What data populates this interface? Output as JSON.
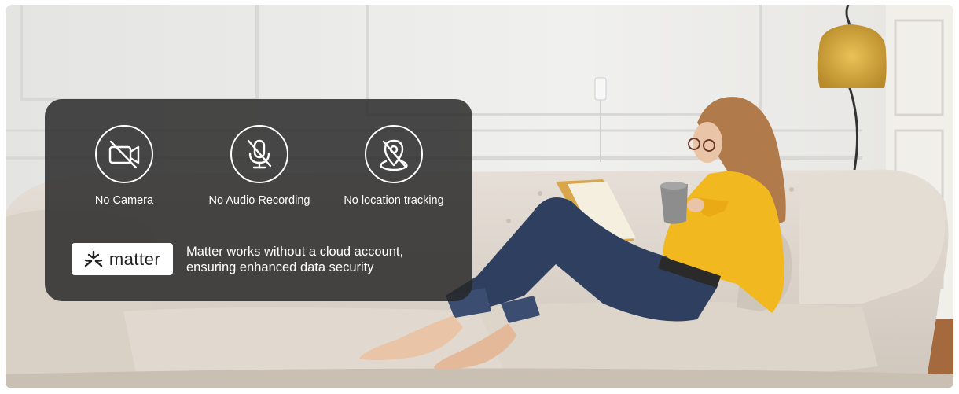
{
  "features": [
    {
      "label": "No Camera",
      "icon": "camera-off-icon"
    },
    {
      "label": "No Audio Recording",
      "icon": "mic-off-icon"
    },
    {
      "label": "No location tracking",
      "icon": "location-off-icon"
    }
  ],
  "matter": {
    "logo_text": "matter",
    "description_line1": "Matter works without a cloud account,",
    "description_line2": "ensuring enhanced data security"
  },
  "colors": {
    "overlay": "#262626",
    "sweater": "#f2b81f",
    "jeans": "#2f3f5f",
    "sofa": "#ddd5cc",
    "wall": "#ececec"
  }
}
